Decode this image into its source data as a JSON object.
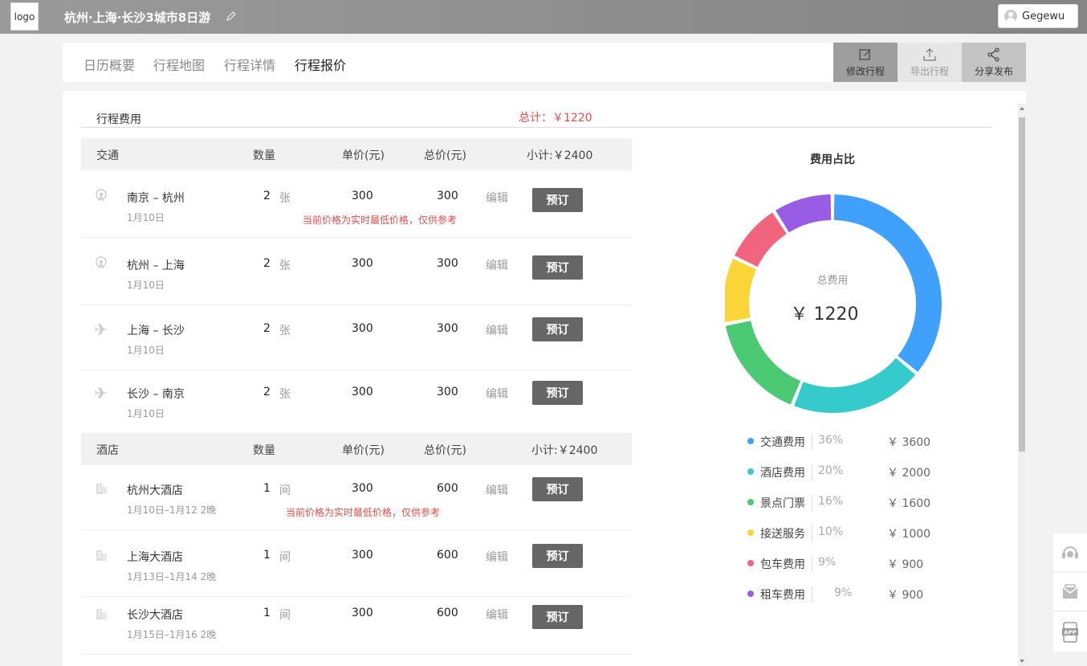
{
  "header": {
    "logo": "logo",
    "title": "杭州·上海·长沙3城市8日游",
    "user": "Gegewu"
  },
  "tabs": [
    {
      "label": "日历概要"
    },
    {
      "label": "行程地图"
    },
    {
      "label": "行程详情"
    },
    {
      "label": "行程报价",
      "active": true
    }
  ],
  "actions": [
    {
      "label": "修改行程",
      "icon": "edit-icon"
    },
    {
      "label": "导出行程",
      "icon": "export-icon"
    },
    {
      "label": "分享发布",
      "icon": "share-icon"
    }
  ],
  "summary": {
    "label": "行程费用",
    "total": "总计：￥1220"
  },
  "transport": {
    "header": {
      "name": "交通",
      "qty": "数量",
      "price": "单价(元)",
      "total": "总价(元)",
      "subtotal": "小计:￥2400"
    },
    "rows": [
      {
        "icon": "train-icon",
        "name": "南京 – 杭州",
        "date": "1月10日",
        "qty": "2",
        "unit": "张",
        "price": "300",
        "total": "300",
        "edit": "编辑",
        "book": "预订",
        "note": "当前价格为实时最低价格，仅供参考"
      },
      {
        "icon": "train-icon",
        "name": "杭州 – 上海",
        "date": "1月10日",
        "qty": "2",
        "unit": "张",
        "price": "300",
        "total": "300",
        "edit": "编辑",
        "book": "预订"
      },
      {
        "icon": "plane-icon",
        "name": "上海 – 长沙",
        "date": "1月10日",
        "qty": "2",
        "unit": "张",
        "price": "300",
        "total": "300",
        "edit": "编辑",
        "book": "预订"
      },
      {
        "icon": "plane-icon",
        "name": "长沙 – 南京",
        "date": "1月10日",
        "qty": "2",
        "unit": "张",
        "price": "300",
        "total": "300",
        "edit": "编辑",
        "book": "预订"
      }
    ]
  },
  "hotel": {
    "header": {
      "name": "酒店",
      "qty": "数量",
      "price": "单价(元)",
      "total": "总价(元)",
      "subtotal": "小计:￥2400"
    },
    "rows": [
      {
        "icon": "hotel-icon",
        "name": "杭州大酒店",
        "date": "1月10日–1月12  2晚",
        "qty": "1",
        "unit": "间",
        "price": "300",
        "total": "600",
        "edit": "编辑",
        "book": "预订",
        "note": "当前价格为实时最低价格，仅供参考"
      },
      {
        "icon": "hotel-icon",
        "name": "上海大酒店",
        "date": "1月13日–1月14  2晚",
        "qty": "1",
        "unit": "间",
        "price": "300",
        "total": "600",
        "edit": "编辑",
        "book": "预订"
      },
      {
        "icon": "hotel-icon",
        "name": "长沙大酒店",
        "date": "1月15日–1月16  2晚",
        "qty": "1",
        "unit": "间",
        "price": "300",
        "total": "600",
        "edit": "编辑",
        "book": "预订"
      }
    ]
  },
  "chart": {
    "title": "费用占比",
    "center_label": "总费用",
    "center_value": "￥ 1220"
  },
  "chart_data": {
    "type": "pie",
    "title": "费用占比",
    "categories": [
      "交通费用",
      "酒店费用",
      "景点门票",
      "接送服务",
      "包车费用",
      "租车费用"
    ],
    "values": [
      3600,
      2000,
      1600,
      1000,
      900,
      900
    ],
    "percent_labels": [
      "36%",
      "20%",
      "16%",
      "10%",
      "9%",
      "9%"
    ],
    "amount_labels": [
      "￥ 3600",
      "￥ 2000",
      "￥ 1600",
      "￥ 1000",
      "￥ 900",
      "￥ 900"
    ],
    "colors": [
      "#3fa1fb",
      "#35cbcc",
      "#4cca73",
      "#fbd438",
      "#f1647d",
      "#985de4"
    ]
  },
  "side_buttons": [
    {
      "icon": "support-icon"
    },
    {
      "icon": "mail-icon"
    },
    {
      "icon": "app-icon",
      "label": "APP"
    }
  ]
}
